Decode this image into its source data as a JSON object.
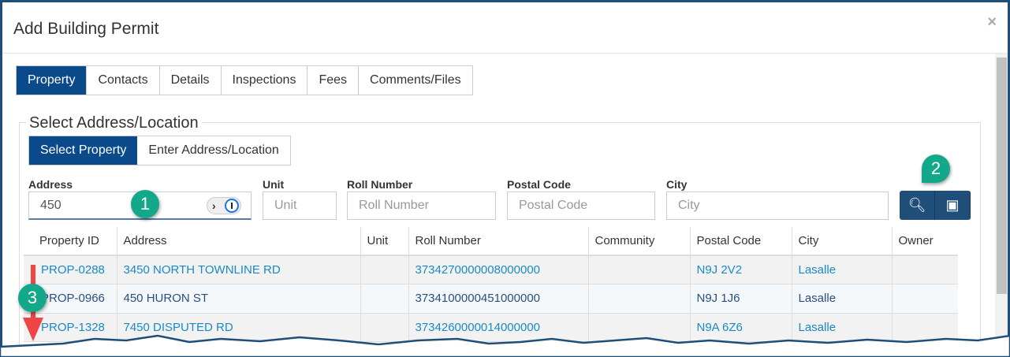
{
  "modal": {
    "title": "Add Building Permit",
    "close": "×"
  },
  "tabs": [
    {
      "label": "Property",
      "active": true
    },
    {
      "label": "Contacts"
    },
    {
      "label": "Details"
    },
    {
      "label": "Inspections"
    },
    {
      "label": "Fees"
    },
    {
      "label": "Comments/Files"
    }
  ],
  "section": {
    "legend": "Select Address/Location",
    "modes": [
      "Select Property",
      "Enter Address/Location"
    ]
  },
  "fields": {
    "address": {
      "label": "Address",
      "value": "450"
    },
    "unit": {
      "label": "Unit",
      "placeholder": "Unit"
    },
    "roll": {
      "label": "Roll Number",
      "placeholder": "Roll Number"
    },
    "postal": {
      "label": "Postal Code",
      "placeholder": "Postal Code"
    },
    "city": {
      "label": "City",
      "placeholder": "City"
    }
  },
  "buttons": {
    "search_icon": "search-icon",
    "map_icon": "map-pin-icon"
  },
  "table": {
    "headers": [
      "Property ID",
      "Address",
      "Unit",
      "Roll Number",
      "Community",
      "Postal Code",
      "City",
      "Owner"
    ],
    "rows": [
      [
        "PROP-0288",
        "3450 NORTH TOWNLINE RD",
        "",
        "3734270000008000000",
        "",
        "N9J 2V2",
        "Lasalle",
        ""
      ],
      [
        "PROP-0966",
        "450 HURON ST",
        "",
        "3734100000451000000",
        "",
        "N9J 1J6",
        "Lasalle",
        ""
      ],
      [
        "PROP-1328",
        "7450 DISPUTED RD",
        "",
        "3734260000014000000",
        "",
        "N9A 6Z6",
        "Lasalle",
        ""
      ]
    ]
  },
  "callouts": [
    "1",
    "2",
    "3"
  ],
  "colors": {
    "primary": "#0a4a8a",
    "button": "#1f4e79",
    "link": "#1a8ac4",
    "callout": "#13a88a",
    "arrow": "#f04545"
  }
}
